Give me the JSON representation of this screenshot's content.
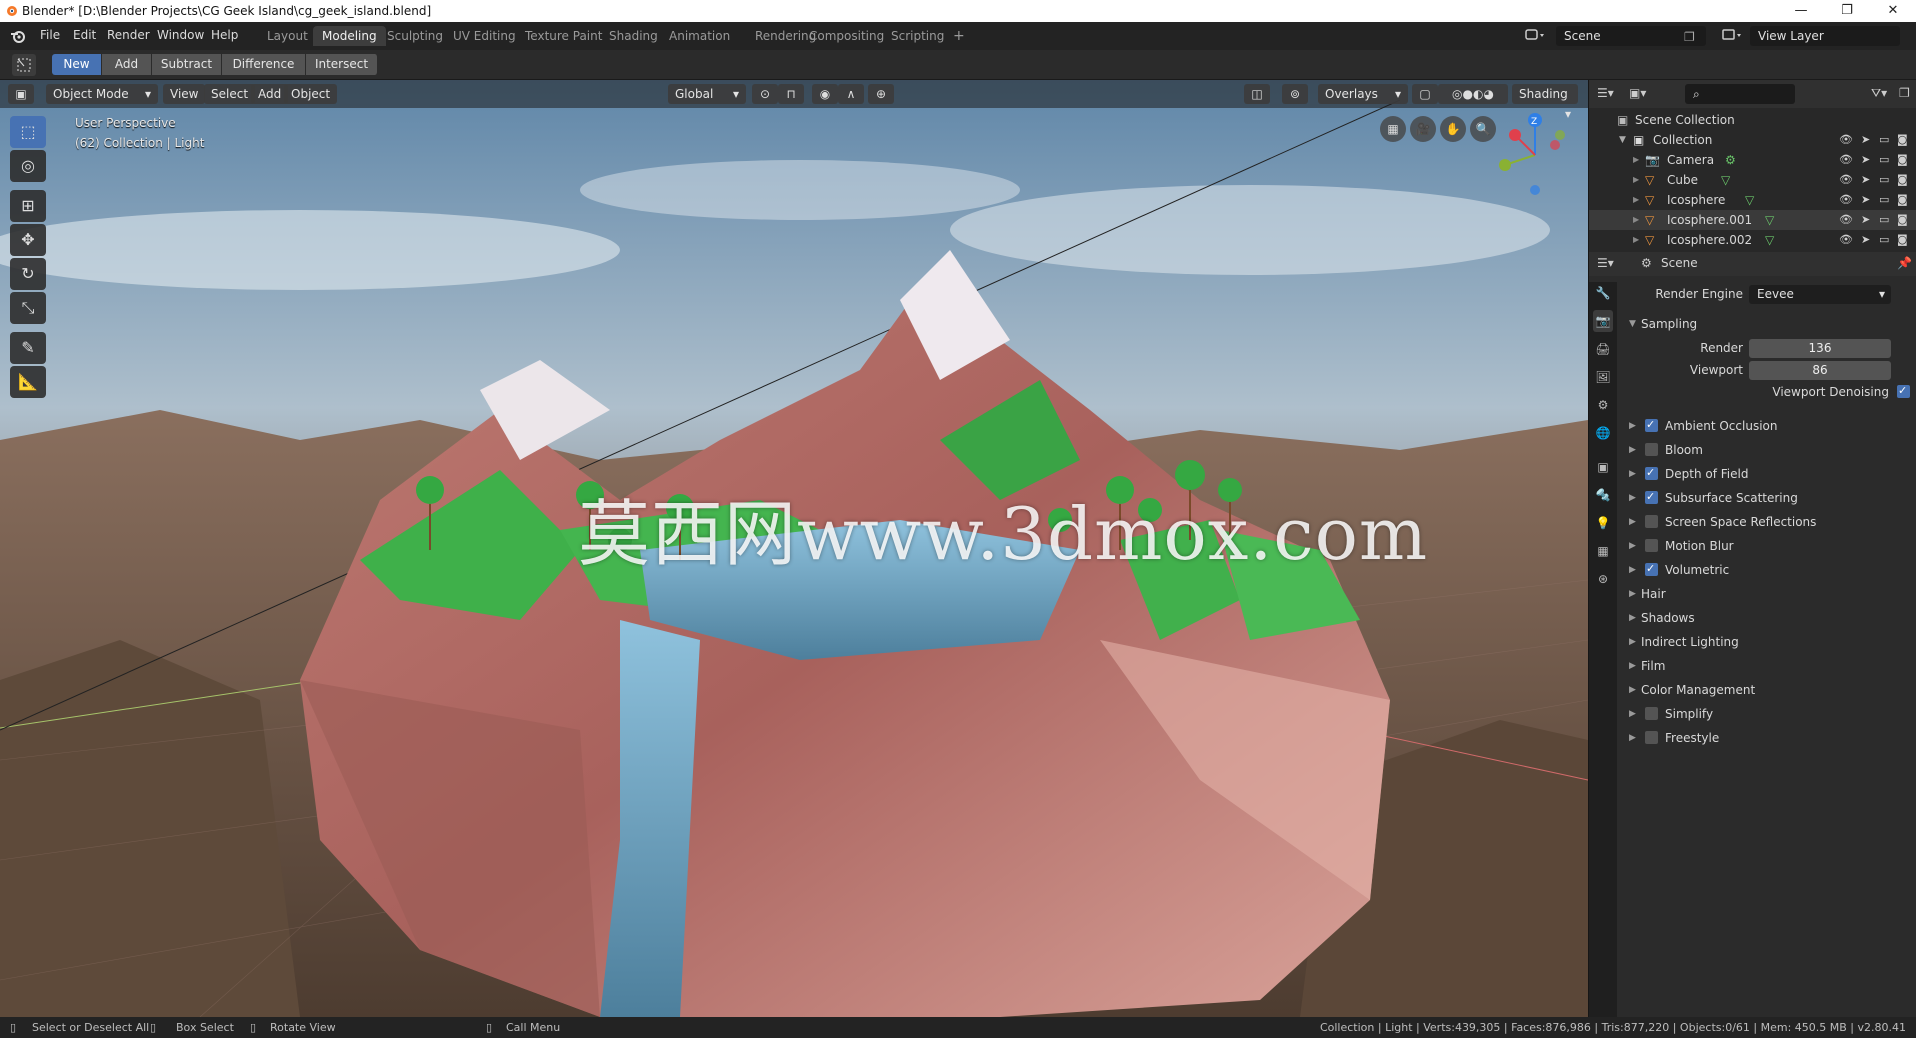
{
  "window": {
    "title": "Blender* [D:\\Blender Projects\\CG Geek Island\\cg_geek_island.blend]",
    "controls": [
      "minimize",
      "maximize",
      "close"
    ]
  },
  "menubar": {
    "menus": [
      "File",
      "Edit",
      "Render",
      "Window",
      "Help"
    ],
    "workspaces": [
      "Layout",
      "Modeling",
      "Sculpting",
      "UV Editing",
      "Texture Paint",
      "Shading",
      "Animation",
      "Rendering",
      "Compositing",
      "Scripting"
    ],
    "active_workspace": "Modeling",
    "add_workspace": "+",
    "scene_name": "Scene",
    "view_layer": "View Layer"
  },
  "tool_settings": {
    "modes": [
      "New",
      "Add",
      "Subtract",
      "Difference",
      "Intersect"
    ],
    "active_mode": "New"
  },
  "viewport": {
    "mode": "Object Mode",
    "menus": [
      "View",
      "Select",
      "Add",
      "Object"
    ],
    "orientation": "Global",
    "overlays_label": "Overlays",
    "shading_label": "Shading",
    "info_line1": "User Perspective",
    "info_line2": "(62) Collection | Light",
    "watermark": "莫西网www.3dmox.com",
    "gizmo_axis_label": "Z"
  },
  "outliner": {
    "root": "Scene Collection",
    "collection": "Collection",
    "items": [
      {
        "name": "Camera",
        "icon": "camera-icon"
      },
      {
        "name": "Cube",
        "icon": "mesh-icon"
      },
      {
        "name": "Icosphere",
        "icon": "mesh-icon"
      },
      {
        "name": "Icosphere.001",
        "icon": "mesh-icon"
      },
      {
        "name": "Icosphere.002",
        "icon": "mesh-icon"
      }
    ],
    "selected_item": "Icosphere.001"
  },
  "properties": {
    "context": "Scene",
    "render_engine_label": "Render Engine",
    "render_engine_value": "Eevee",
    "sampling_label": "Sampling",
    "render_label": "Render",
    "render_value": "136",
    "viewport_label": "Viewport",
    "viewport_value": "86",
    "viewport_denoising_label": "Viewport Denoising",
    "panels": [
      {
        "label": "Ambient Occlusion",
        "checkbox": true,
        "checked": true
      },
      {
        "label": "Bloom",
        "checkbox": true,
        "checked": false
      },
      {
        "label": "Depth of Field",
        "checkbox": true,
        "checked": true
      },
      {
        "label": "Subsurface Scattering",
        "checkbox": true,
        "checked": true
      },
      {
        "label": "Screen Space Reflections",
        "checkbox": true,
        "checked": false
      },
      {
        "label": "Motion Blur",
        "checkbox": true,
        "checked": false
      },
      {
        "label": "Volumetric",
        "checkbox": true,
        "checked": true
      },
      {
        "label": "Hair",
        "checkbox": false,
        "checked": false
      },
      {
        "label": "Shadows",
        "checkbox": false,
        "checked": false
      },
      {
        "label": "Indirect Lighting",
        "checkbox": false,
        "checked": false
      },
      {
        "label": "Film",
        "checkbox": false,
        "checked": false
      },
      {
        "label": "Color Management",
        "checkbox": false,
        "checked": false
      },
      {
        "label": "Simplify",
        "checkbox": true,
        "checked": false
      },
      {
        "label": "Freestyle",
        "checkbox": true,
        "checked": false
      }
    ]
  },
  "statusbar": {
    "left": [
      "Select or Deselect All",
      "Box Select",
      "Rotate View",
      "Call Menu"
    ],
    "right": "Collection | Light | Verts:439,305 | Faces:876,986 | Tris:877,220 | Objects:0/61 | Mem: 450.5 MB | v2.80.41"
  },
  "colors": {
    "accent": "#4772b3",
    "island": "#c9837b",
    "grass": "#3fb04a",
    "water": "#6ea7c8"
  }
}
